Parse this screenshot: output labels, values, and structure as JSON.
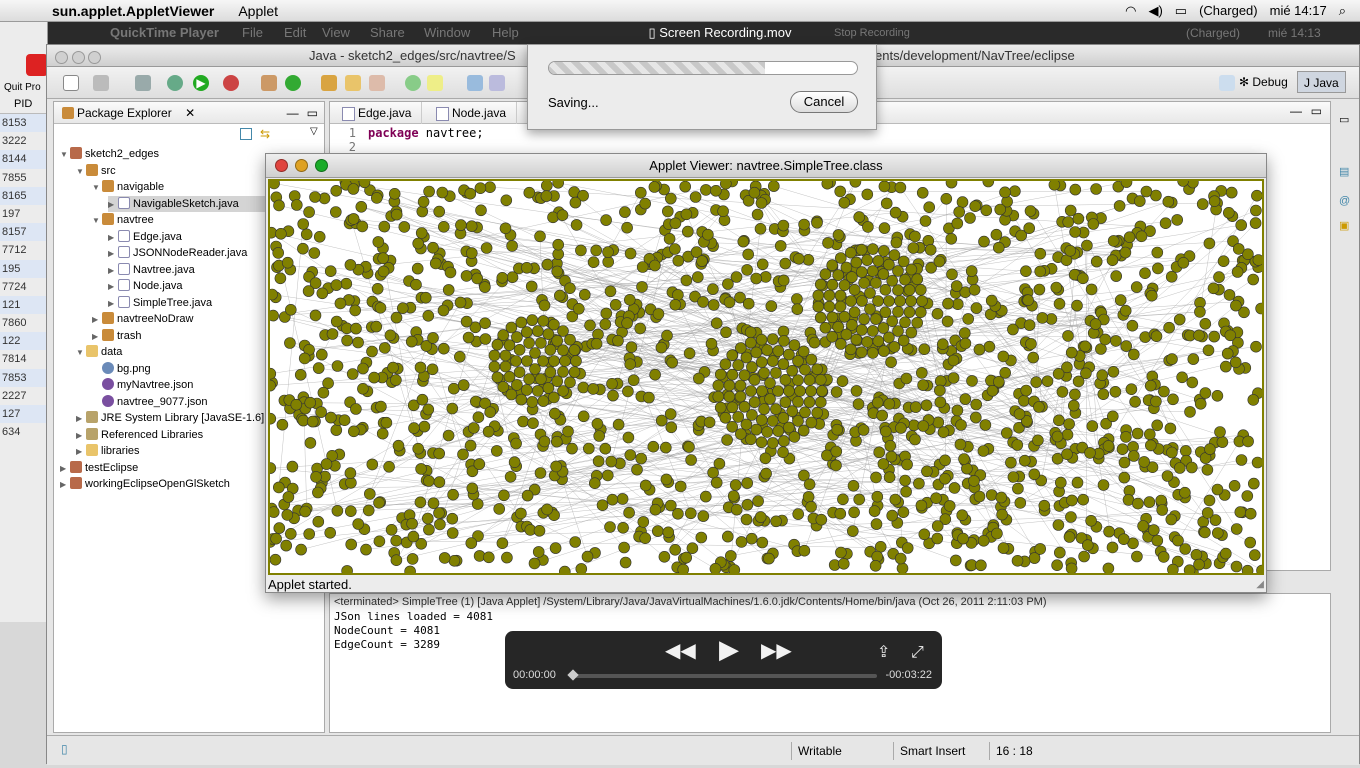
{
  "menubar": {
    "app_name": "sun.applet.AppletViewer",
    "menu": "Applet",
    "battery": "(Charged)",
    "clock": "mié 14:17"
  },
  "quicktime_menu": {
    "app": "QuickTime Player",
    "items": [
      "File",
      "Edit",
      "View",
      "Share",
      "Window",
      "Help"
    ],
    "stop_recording": "Stop Recording",
    "battery": "(Charged)",
    "clock": "mié 14:13"
  },
  "background_window": {
    "quit_label": "Quit Pro",
    "column": "PID",
    "pids": [
      "8153",
      "3222",
      "8144",
      "7855",
      "8165",
      "197",
      "8157",
      "7712",
      "195",
      "7724",
      "121",
      "7860",
      "122",
      "7814",
      "7853",
      "2227",
      "127",
      "634"
    ]
  },
  "eclipse": {
    "window_title_left": "Java - sketch2_edges/src/navtree/S",
    "window_title_right": "ents/development/NavTree/eclipse",
    "perspectives": [
      "Debug",
      "Java"
    ],
    "package_explorer": {
      "tab": "Package Explorer",
      "tree": [
        {
          "label": "sketch2_edges",
          "depth": 0,
          "icon": "proj",
          "twisty": "▼"
        },
        {
          "label": "src",
          "depth": 1,
          "icon": "pkg",
          "twisty": "▼"
        },
        {
          "label": "navigable",
          "depth": 2,
          "icon": "pkg",
          "twisty": "▼"
        },
        {
          "label": "NavigableSketch.java",
          "depth": 3,
          "icon": "java",
          "twisty": "▶"
        },
        {
          "label": "navtree",
          "depth": 2,
          "icon": "pkg",
          "twisty": "▼"
        },
        {
          "label": "Edge.java",
          "depth": 3,
          "icon": "java",
          "twisty": "▶"
        },
        {
          "label": "JSONNodeReader.java",
          "depth": 3,
          "icon": "java",
          "twisty": "▶"
        },
        {
          "label": "Navtree.java",
          "depth": 3,
          "icon": "java",
          "twisty": "▶"
        },
        {
          "label": "Node.java",
          "depth": 3,
          "icon": "java",
          "twisty": "▶"
        },
        {
          "label": "SimpleTree.java",
          "depth": 3,
          "icon": "java",
          "twisty": "▶"
        },
        {
          "label": "navtreeNoDraw",
          "depth": 2,
          "icon": "pkg",
          "twisty": "▶"
        },
        {
          "label": "trash",
          "depth": 2,
          "icon": "pkg",
          "twisty": "▶"
        },
        {
          "label": "data",
          "depth": 1,
          "icon": "folder",
          "twisty": "▼"
        },
        {
          "label": "bg.png",
          "depth": 2,
          "icon": "img",
          "twisty": ""
        },
        {
          "label": "myNavtree.json",
          "depth": 2,
          "icon": "json",
          "twisty": ""
        },
        {
          "label": "navtree_9077.json",
          "depth": 2,
          "icon": "json",
          "twisty": ""
        },
        {
          "label": "JRE System Library [JavaSE-1.6]",
          "depth": 1,
          "icon": "lib",
          "twisty": "▶"
        },
        {
          "label": "Referenced Libraries",
          "depth": 1,
          "icon": "lib",
          "twisty": "▶"
        },
        {
          "label": "libraries",
          "depth": 1,
          "icon": "folder",
          "twisty": "▶"
        },
        {
          "label": "testEclipse",
          "depth": 0,
          "icon": "proj",
          "twisty": "▶"
        },
        {
          "label": "workingEclipseOpenGlSketch",
          "depth": 0,
          "icon": "proj",
          "twisty": "▶"
        }
      ]
    },
    "editor": {
      "tabs": [
        "Edge.java",
        "Node.java"
      ],
      "line1_keyword": "package",
      "line1_rest": " navtree;",
      "line_numbers": [
        "1",
        "2"
      ]
    },
    "console": {
      "header": "<terminated> SimpleTree (1) [Java Applet] /System/Library/Java/JavaVirtualMachines/1.6.0.jdk/Contents/Home/bin/java (Oct 26, 2011 2:11:03 PM)",
      "lines": [
        "JSon lines loaded = 4081",
        "NodeCount = 4081",
        "EdgeCount = 3289"
      ]
    },
    "status": {
      "writable": "Writable",
      "insert_mode": "Smart Insert",
      "position": "16 : 18"
    }
  },
  "save_dialog": {
    "label": "Saving...",
    "cancel": "Cancel",
    "progress": 0.7
  },
  "applet": {
    "title": "Applet Viewer: navtree.SimpleTree.class",
    "status": "Applet started.",
    "node_color": "#808000",
    "node_count": 4081,
    "edge_count": 3289
  },
  "player": {
    "title": "Screen Recording.mov",
    "elapsed": "00:00:00",
    "remaining": "-00:03:22"
  }
}
